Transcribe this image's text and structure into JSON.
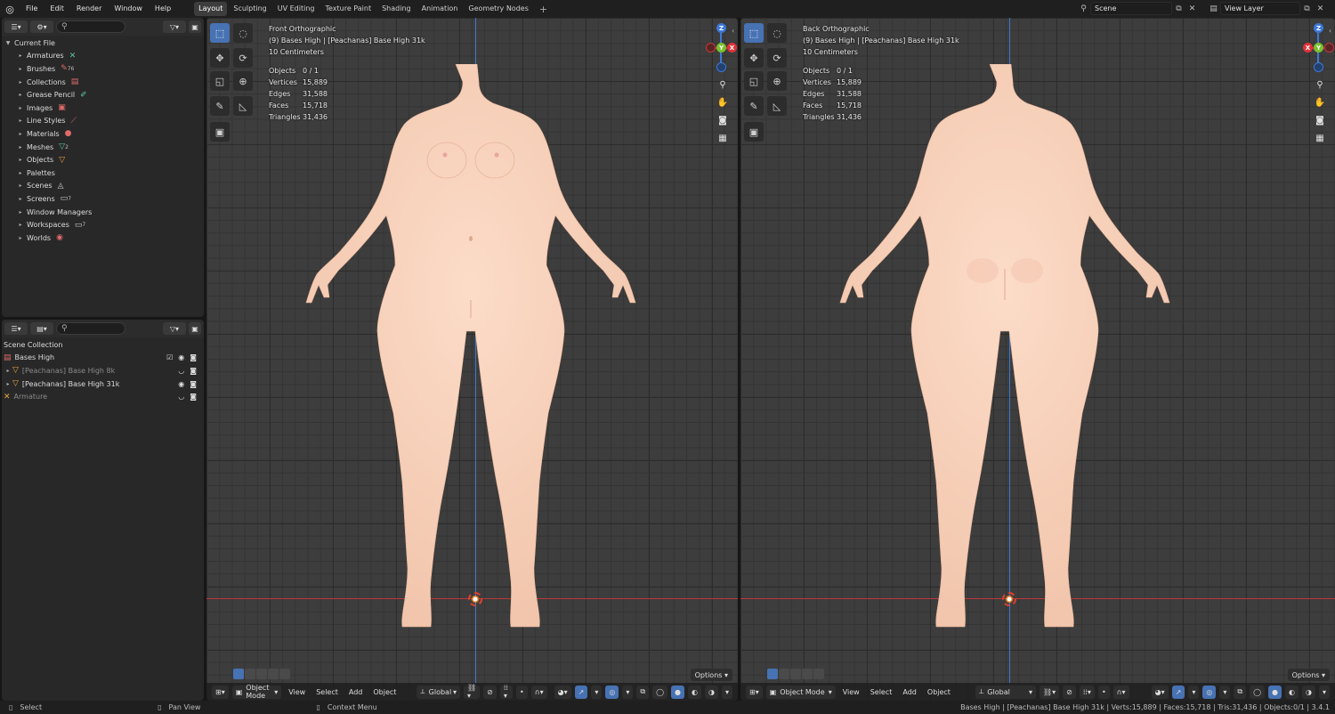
{
  "app_menu": [
    "File",
    "Edit",
    "Render",
    "Window",
    "Help"
  ],
  "workspace_tabs": [
    "Layout",
    "Sculpting",
    "UV Editing",
    "Texture Paint",
    "Shading",
    "Animation",
    "Geometry Nodes"
  ],
  "active_tab": "Layout",
  "add_tab": "+",
  "scene": {
    "label": "Scene"
  },
  "view_layer": {
    "label": "View Layer"
  },
  "outliner_top": {
    "root": "Current File",
    "items": [
      {
        "label": "Armatures",
        "icon": "armature-icon",
        "count": ""
      },
      {
        "label": "Brushes",
        "icon": "brush-icon",
        "count": "76"
      },
      {
        "label": "Collections",
        "icon": "collection-icon",
        "count": ""
      },
      {
        "label": "Grease Pencil",
        "icon": "grease-pencil-icon",
        "count": ""
      },
      {
        "label": "Images",
        "icon": "image-icon",
        "count": ""
      },
      {
        "label": "Line Styles",
        "icon": "line-style-icon",
        "count": ""
      },
      {
        "label": "Materials",
        "icon": "material-icon",
        "count": ""
      },
      {
        "label": "Meshes",
        "icon": "mesh-icon",
        "count": "2"
      },
      {
        "label": "Objects",
        "icon": "object-icon",
        "count": ""
      },
      {
        "label": "Palettes",
        "icon": "palette-icon",
        "count": ""
      },
      {
        "label": "Scenes",
        "icon": "scene-icon",
        "count": ""
      },
      {
        "label": "Screens",
        "icon": "screen-icon",
        "count": "7"
      },
      {
        "label": "Window Managers",
        "icon": "window-icon",
        "count": ""
      },
      {
        "label": "Workspaces",
        "icon": "workspace-icon",
        "count": "7"
      },
      {
        "label": "Worlds",
        "icon": "world-icon",
        "count": ""
      }
    ]
  },
  "outliner_bottom": {
    "root": "Scene Collection",
    "rows": [
      {
        "label": "Bases High",
        "dim": false
      },
      {
        "label": "[Peachanas] Base High 8k",
        "dim": true
      },
      {
        "label": "[Peachanas] Base High 31k",
        "dim": false
      },
      {
        "label": "Armature",
        "dim": true
      }
    ]
  },
  "viewports": [
    {
      "view": "Front Orthographic",
      "object": "(9) Bases High | [Peachanas] Base High 31k",
      "scale": "10 Centimeters",
      "stats": [
        {
          "k": "Objects",
          "v": "0 / 1"
        },
        {
          "k": "Vertices",
          "v": "15,889"
        },
        {
          "k": "Edges",
          "v": "31,588"
        },
        {
          "k": "Faces",
          "v": "15,718"
        },
        {
          "k": "Triangles",
          "v": "31,436"
        }
      ],
      "gizmo": {
        "up": "Z",
        "right": "X",
        "center": "Y"
      }
    },
    {
      "view": "Back Orthographic",
      "object": "(9) Bases High | [Peachanas] Base High 31k",
      "scale": "10 Centimeters",
      "stats": [
        {
          "k": "Objects",
          "v": "0 / 1"
        },
        {
          "k": "Vertices",
          "v": "15,889"
        },
        {
          "k": "Edges",
          "v": "31,588"
        },
        {
          "k": "Faces",
          "v": "15,718"
        },
        {
          "k": "Triangles",
          "v": "31,436"
        }
      ],
      "gizmo": {
        "up": "Z",
        "left": "X",
        "center": "Y"
      }
    }
  ],
  "header": {
    "mode": "Object Mode",
    "menus": [
      "View",
      "Select",
      "Add",
      "Object"
    ],
    "orientation": "Global",
    "options": "Options"
  },
  "status": {
    "left": "Select",
    "mid": "Pan View",
    "ctx": "Context Menu",
    "right": "Bases High | [Peachanas] Base High 31k | Verts:15,889 | Faces:15,718 | Tris:31,436 | Objects:0/1 | 3.4.1"
  },
  "colors": {
    "accent": "#4772b3",
    "skin": "#f7d2bd",
    "x_axis": "#e0333a",
    "y_axis": "#7ac02b",
    "z_axis": "#3c78d8"
  }
}
